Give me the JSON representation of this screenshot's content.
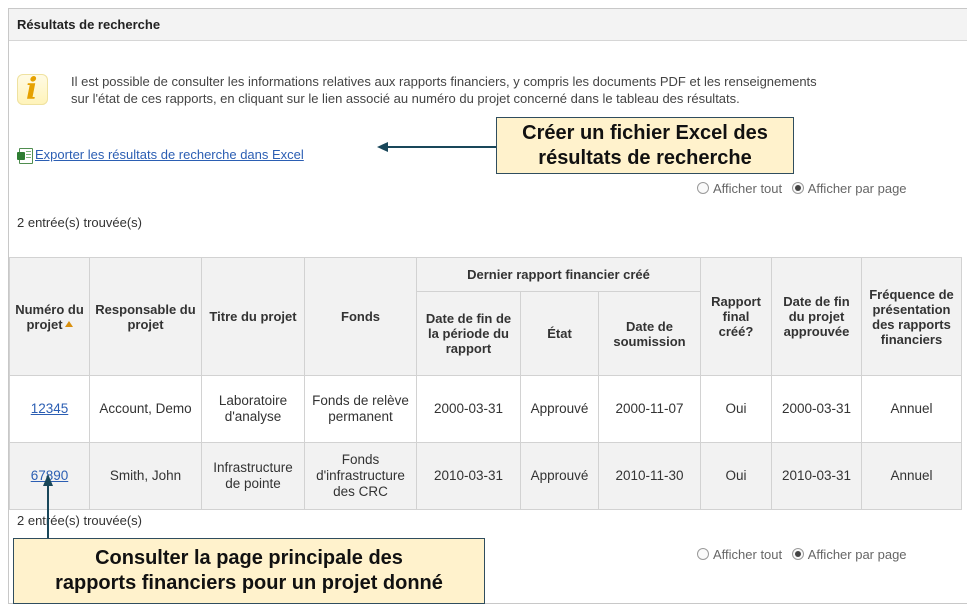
{
  "panel": {
    "title": "Résultats de recherche"
  },
  "info": {
    "icon": "info-icon",
    "line1": "Il est possible de consulter les informations relatives aux rapports financiers, y compris les documents PDF et les renseignements",
    "line2": "sur l'état de ces rapports, en cliquant sur le lien associé au numéro du projet concerné dans le tableau des résultats."
  },
  "export": {
    "icon": "excel-icon",
    "label": "Exporter les résultats de recherche dans Excel"
  },
  "callouts": {
    "excel_line1": "Créer un fichier Excel des",
    "excel_line2": "résultats de recherche",
    "project_line1": "Consulter la page principale des",
    "project_line2": "rapports financiers pour un projet donné"
  },
  "view_options": {
    "show_all": "Afficher tout",
    "per_page": "Afficher par page",
    "selected": "per_page"
  },
  "results_count": "2 entrée(s) trouvée(s)",
  "table": {
    "headers": {
      "project_number": "Numéro du projet",
      "manager": "Responsable du projet",
      "title": "Titre du projet",
      "fund": "Fonds",
      "last_report_group": "Dernier rapport financier créé",
      "period_end": "Date de fin de la période du rapport",
      "status": "État",
      "submission_date": "Date de soumission",
      "final_report": "Rapport final créé?",
      "approved_end_date": "Date de fin du projet approuvée",
      "frequency": "Fréquence de présentation des rapports financiers"
    },
    "rows": [
      {
        "project_number": "12345",
        "manager": "Account, Demo",
        "title": "Laboratoire d'analyse",
        "fund": "Fonds de relève permanent",
        "period_end": "2000-03-31",
        "status": "Approuvé",
        "submission_date": "2000-11-07",
        "final_report": "Oui",
        "approved_end_date": "2000-03-31",
        "frequency": "Annuel"
      },
      {
        "project_number": "67890",
        "manager": "Smith, John",
        "title": "Infrastructure de pointe",
        "fund": "Fonds d'infrastructure des CRC",
        "period_end": "2010-03-31",
        "status": "Approuvé",
        "submission_date": "2010-11-30",
        "final_report": "Oui",
        "approved_end_date": "2010-03-31",
        "frequency": "Annuel"
      }
    ]
  },
  "colors": {
    "link": "#2b5eb3",
    "callout_bg": "#fff2cc",
    "arrow": "#19475a",
    "header_bg": "#f2f2f2"
  }
}
